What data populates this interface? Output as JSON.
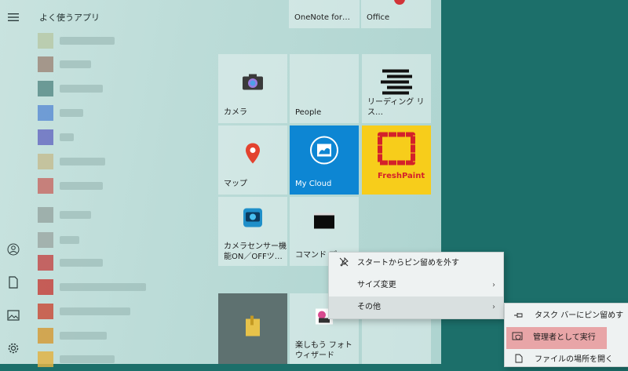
{
  "start_menu": {
    "apps_header": "よく使うアプリ",
    "rail_icons": [
      "hamburger-icon",
      "user-icon",
      "document-icon",
      "pictures-icon",
      "settings-icon"
    ],
    "blurred_apps": [
      {
        "color": "#b7c9a8",
        "w": 70
      },
      {
        "color": "#9e8a7c",
        "w": 40
      },
      {
        "color": "#5a8d8a",
        "w": 55
      },
      {
        "color": "#5f8fd3",
        "w": 30
      },
      {
        "color": "#6a6fc2",
        "w": 18
      },
      {
        "color": "#c4bd93",
        "w": 58
      },
      {
        "color": "#c76f6a",
        "w": 55
      },
      {
        "color": "#98a7a3",
        "w": 40
      },
      {
        "color": "#9da9a6",
        "w": 25
      },
      {
        "color": "#c34d4d",
        "w": 55
      },
      {
        "color": "#c5453f",
        "w": 110
      },
      {
        "color": "#c9503d",
        "w": 90
      },
      {
        "color": "#d49c3a",
        "w": 60
      },
      {
        "color": "#e0b445",
        "w": 70
      }
    ],
    "tiles": {
      "onenote": "OneNote for…",
      "office": "Office",
      "camera": "カメラ",
      "people": "People",
      "reading": "リーディング リス…",
      "maps": "マップ",
      "mycloud": "My Cloud",
      "freshpaint": "FreshPaint",
      "freshpaint_logo": "FreshPaint",
      "camera_sensor_line1": "カメラセンサー機",
      "camera_sensor_line2": "能ON／OFFツ…",
      "command": "コマンド プ",
      "photo_line1": "楽しもう フォト",
      "photo_line2": "ウィザード"
    }
  },
  "context_menu": {
    "unpin": "スタートからピン留めを外す",
    "resize": "サイズ変更",
    "more": "その他"
  },
  "submenu": {
    "pin_taskbar": "タスク バーにピン留めする",
    "run_admin": "管理者として実行",
    "open_location": "ファイルの場所を開く"
  },
  "colors": {
    "mycloud_bg": "#0d86d3",
    "freshpaint_bg": "#f7cd1b",
    "freshpaint_red": "#d4212a",
    "desktop_bg": "#1c6f6a",
    "admin_highlight": "#e8a5a7"
  }
}
